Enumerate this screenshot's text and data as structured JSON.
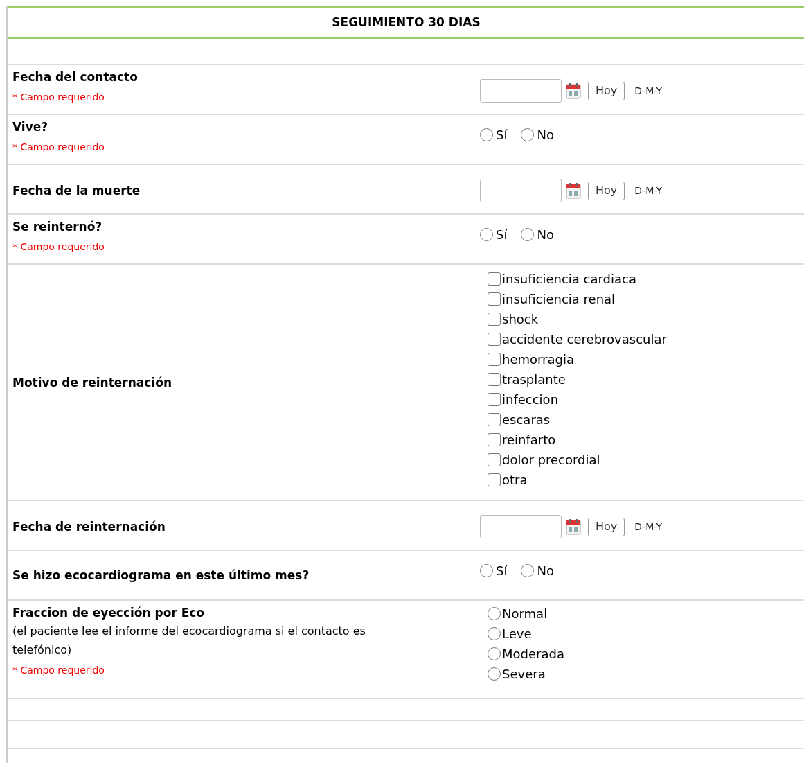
{
  "header": {
    "title": "SEGUIMIENTO 30 DIAS"
  },
  "rows": [
    {
      "label": "Fecha del contacto",
      "required": "* Campo requerido",
      "kind": "date",
      "button": "Hoy",
      "format": "D-M-Y"
    },
    {
      "label": "Vive?",
      "required": "* Campo requerido",
      "kind": "radio",
      "options": [
        {
          "label": "Sí",
          "selected": false
        },
        {
          "label": "No",
          "selected": false
        }
      ]
    },
    {
      "label": "Fecha de la muerte",
      "kind": "date",
      "button": "Hoy",
      "format": "D-M-Y"
    },
    {
      "label": "Se reinternó?",
      "required": "* Campo requerido",
      "kind": "radio",
      "options": [
        {
          "label": "Sí",
          "selected": false
        },
        {
          "label": "No",
          "selected": false
        }
      ]
    },
    {
      "label": "Motivo de reinternación",
      "kind": "checklist",
      "options": [
        {
          "label": "insuficiencia cardiaca",
          "checked": false
        },
        {
          "label": "insuficiencia renal",
          "checked": false
        },
        {
          "label": "shock",
          "checked": false
        },
        {
          "label": "accidente cerebrovascular",
          "checked": false
        },
        {
          "label": "hemorragia",
          "checked": false
        },
        {
          "label": "trasplante",
          "checked": false
        },
        {
          "label": "infeccion",
          "checked": false
        },
        {
          "label": "escaras",
          "checked": false
        },
        {
          "label": "reinfarto",
          "checked": false
        },
        {
          "label": "dolor precordial",
          "checked": false
        },
        {
          "label": "otra",
          "checked": false
        }
      ]
    },
    {
      "label": "Fecha de reinternación",
      "kind": "date",
      "button": "Hoy",
      "format": "D-M-Y"
    },
    {
      "label": "Se hizo ecocardiograma en este último mes?",
      "kind": "radio",
      "options": [
        {
          "label": "Sí",
          "selected": false
        },
        {
          "label": "No",
          "selected": false
        }
      ]
    },
    {
      "label": "Fraccion de eyección por Eco",
      "note": "(el paciente lee el informe del ecocardiograma si el contacto es telefónico)",
      "required": "* Campo requerido",
      "kind": "radiolist",
      "options": [
        {
          "label": "Normal",
          "selected": false
        },
        {
          "label": "Leve",
          "selected": false
        },
        {
          "label": "Moderada",
          "selected": false
        },
        {
          "label": "Severa",
          "selected": false
        }
      ]
    }
  ]
}
